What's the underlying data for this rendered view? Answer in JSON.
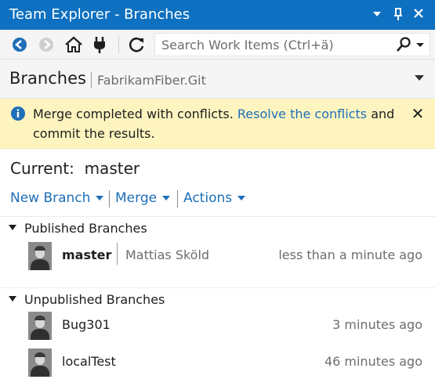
{
  "window": {
    "title": "Team Explorer - Branches"
  },
  "toolbar": {
    "search_placeholder": "Search Work Items (Ctrl+ä)"
  },
  "header": {
    "title": "Branches",
    "repository": "FabrikamFiber.Git"
  },
  "notification": {
    "message_start": "Merge completed with conflicts.",
    "link_text": "Resolve the conflicts",
    "message_end": "and",
    "message_line2": "commit the results."
  },
  "current_branch": {
    "label": "Current:",
    "name": "master"
  },
  "actions": {
    "new_branch": "New Branch",
    "merge": "Merge",
    "actions": "Actions"
  },
  "published": {
    "heading": "Published Branches",
    "branches": [
      {
        "name": "master",
        "author": "Mattias Sköld",
        "time": "less than a minute ago"
      }
    ]
  },
  "unpublished": {
    "heading": "Unpublished Branches",
    "branches": [
      {
        "name": "Bug301",
        "time": "3 minutes ago"
      },
      {
        "name": "localTest",
        "time": "46 minutes ago"
      }
    ]
  },
  "colors": {
    "accent": "#0e70c0",
    "link": "#1e6fb8",
    "banner_bg": "#fdf4bf",
    "muted_text": "#6d6d6d"
  },
  "icons": [
    "back-icon",
    "forward-icon",
    "home-icon",
    "connect-icon",
    "refresh-icon",
    "search-icon",
    "info-icon",
    "close-icon",
    "pin-icon",
    "dropdown-icon"
  ]
}
